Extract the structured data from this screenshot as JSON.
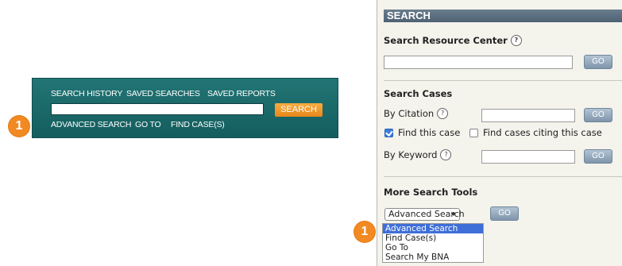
{
  "left_bar": {
    "links_top": [
      "SEARCH HISTORY",
      "SAVED SEARCHES",
      "SAVED REPORTS"
    ],
    "links_bottom": [
      "ADVANCED SEARCH",
      "GO TO",
      "FIND CASE(S)"
    ],
    "search_button": "SEARCH",
    "search_value": ""
  },
  "markers": [
    "1",
    "1"
  ],
  "panel": {
    "header": "SEARCH",
    "resource_center": {
      "title": "Search Resource Center",
      "help": "?",
      "go": "GO",
      "value": ""
    },
    "cases": {
      "title": "Search Cases",
      "by_citation": "By Citation",
      "by_keyword": "By Keyword",
      "help": "?",
      "go": "GO",
      "find_this_case": "Find this case",
      "find_citing": "Find cases citing this case",
      "find_this_case_checked": true,
      "find_citing_checked": false
    },
    "more_tools": {
      "title": "More Search Tools",
      "selected": "Advanced Search",
      "go": "GO",
      "options": [
        "Advanced Search",
        "Find Case(s)",
        "Go To",
        "Search My BNA"
      ]
    }
  },
  "colors": {
    "bar_teal": "#1a6b6b",
    "accent_orange": "#f39a25",
    "panel_header": "#5a6e7f",
    "go_button": "#8ea3b7",
    "selected_option": "#3e6fd8"
  }
}
